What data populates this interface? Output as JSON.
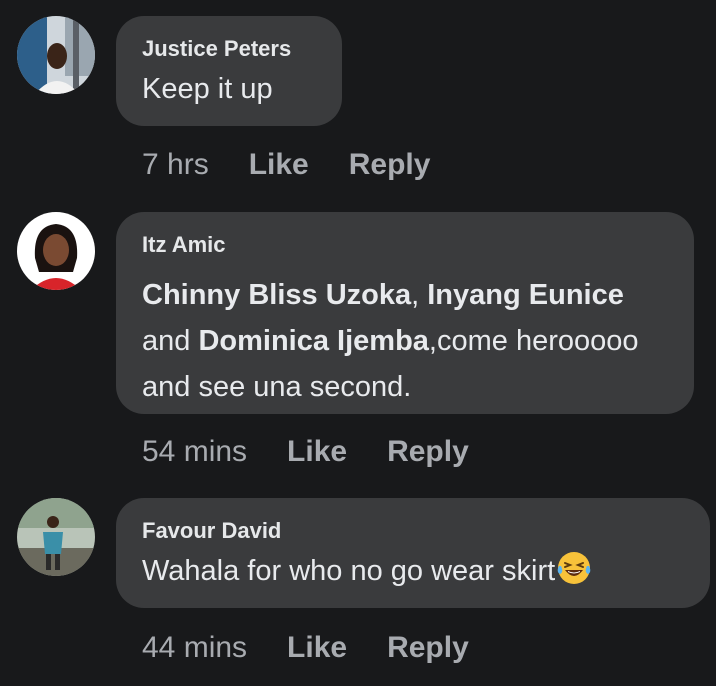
{
  "comments": [
    {
      "author": "Justice Peters",
      "text": "Keep it up",
      "time": "7 hrs",
      "like_label": "Like",
      "reply_label": "Reply"
    },
    {
      "author": "Itz Amic",
      "mention_1": "Chinny Bliss Uzoka",
      "sep_1": ", ",
      "mention_2": "Inyang Eunice",
      "sep_2": "and ",
      "mention_3": "Dominica Ijemba",
      "text_tail": ",come herooooo and see una second.",
      "time": "54 mins",
      "like_label": "Like",
      "reply_label": "Reply"
    },
    {
      "author": "Favour David",
      "text": "Wahala for who no go wear skirt",
      "emoji": "laughing-tears-emoji",
      "time": "44 mins",
      "like_label": "Like",
      "reply_label": "Reply"
    }
  ],
  "colors": {
    "background": "#18191b",
    "bubble": "#3a3b3d",
    "meta_text": "#a8abb0"
  }
}
